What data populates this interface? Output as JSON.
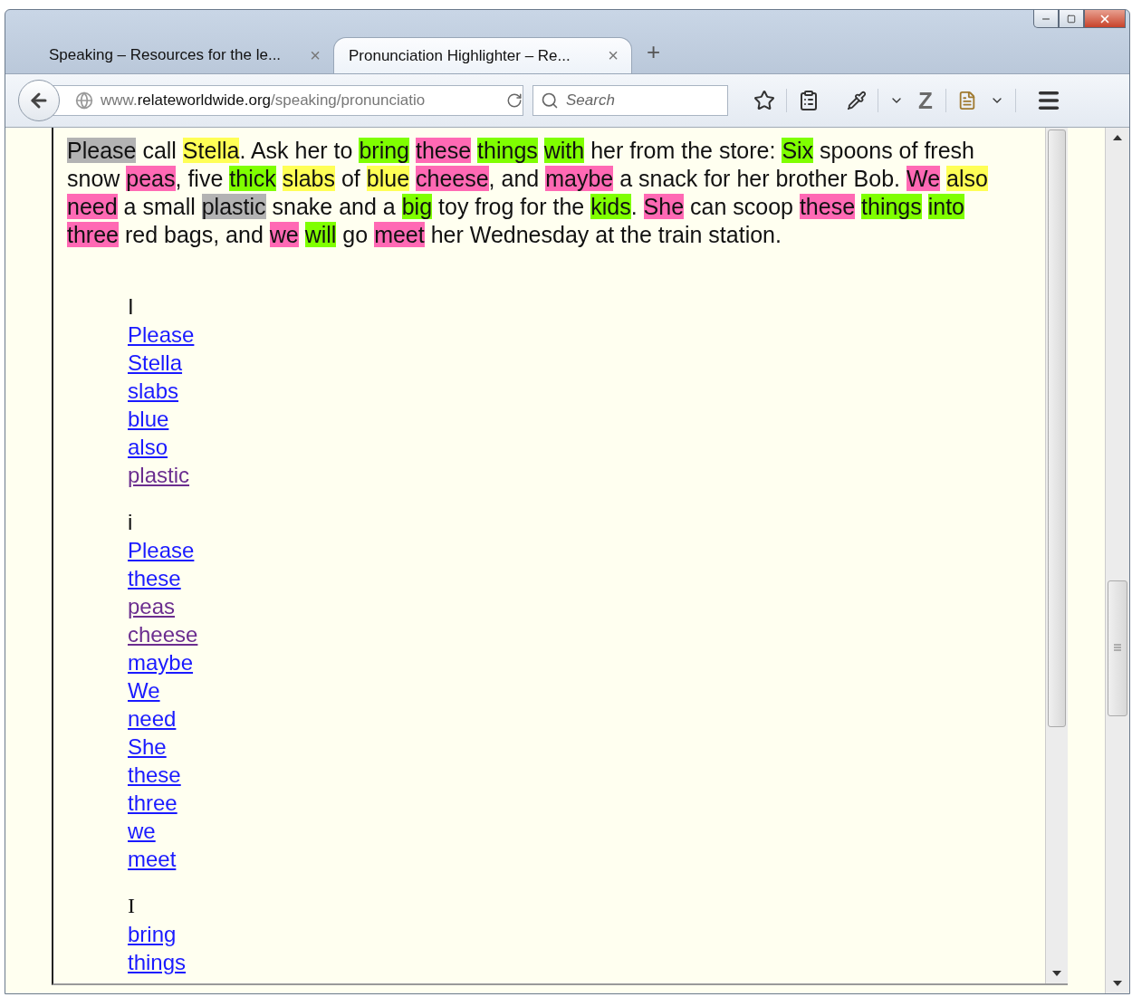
{
  "tabs": [
    {
      "title": "Speaking – Resources for the le...",
      "close": "×",
      "selected": false
    },
    {
      "title": "Pronunciation Highlighter – Re...",
      "close": "×",
      "selected": true
    }
  ],
  "new_tab": "+",
  "address_bar": {
    "url": "www.**relateworldwide.org**/speaking/pronunciatio"
  },
  "search": {
    "placeholder": "Search"
  },
  "toolbar_logo": "Z",
  "paragraph": [
    {
      "text": "Please",
      "color": "#b3b3b3"
    },
    {
      "text": " call "
    },
    {
      "text": "Stella",
      "color": "#ffff55"
    },
    {
      "text": ". Ask her to "
    },
    {
      "text": "bring ",
      "color": "#7fff00"
    },
    {
      "text": "these ",
      "color": "#ff69b4"
    },
    {
      "text": "things ",
      "color": "#7fff00"
    },
    {
      "text": "with",
      "color": "#7fff00"
    },
    {
      "text": " her from the store: "
    },
    {
      "text": "Six",
      "color": "#7fff00"
    },
    {
      "text": " spoons of fresh snow "
    },
    {
      "text": "peas",
      "color": "#ff69b4"
    },
    {
      "text": ", five "
    },
    {
      "text": "thick ",
      "color": "#7fff00"
    },
    {
      "text": "slabs",
      "color": "#ffff55"
    },
    {
      "text": " of "
    },
    {
      "text": "blue ",
      "color": "#ffff55"
    },
    {
      "text": "cheese",
      "color": "#ff69b4"
    },
    {
      "text": ", and "
    },
    {
      "text": "maybe",
      "color": "#ff69b4"
    },
    {
      "text": " a snack for her brother Bob. "
    },
    {
      "text": "We ",
      "color": "#ff69b4"
    },
    {
      "text": "also ",
      "color": "#ffff55"
    },
    {
      "text": "need",
      "color": "#ff69b4"
    },
    {
      "text": " a small "
    },
    {
      "text": "plastic",
      "color": "#b3b3b3"
    },
    {
      "text": " snake and a "
    },
    {
      "text": "big",
      "color": "#7fff00"
    },
    {
      "text": " toy frog for the "
    },
    {
      "text": "kids",
      "color": "#7fff00"
    },
    {
      "text": ". "
    },
    {
      "text": "She",
      "color": "#ff69b4"
    },
    {
      "text": " can scoop "
    },
    {
      "text": "these ",
      "color": "#ff69b4"
    },
    {
      "text": "things ",
      "color": "#7fff00"
    },
    {
      "text": "into ",
      "color": "#7fff00"
    },
    {
      "text": "three",
      "color": "#ff69b4"
    },
    {
      "text": " red bags, and "
    },
    {
      "text": "we ",
      "color": "#ff69b4"
    },
    {
      "text": "will",
      "color": "#7fff00"
    },
    {
      "text": " go "
    },
    {
      "text": "meet",
      "color": "#ff69b4"
    },
    {
      "text": " her Wednesday at the train station."
    }
  ],
  "groups": [
    {
      "heading": "I",
      "kind": "sans",
      "links": [
        {
          "text": "Please",
          "visited": false
        },
        {
          "text": "Stella",
          "visited": false
        },
        {
          "text": "slabs",
          "visited": false
        },
        {
          "text": "blue",
          "visited": false
        },
        {
          "text": "also",
          "visited": false
        },
        {
          "text": "plastic",
          "visited": true
        }
      ]
    },
    {
      "heading": "i",
      "kind": "sans",
      "links": [
        {
          "text": "Please",
          "visited": false
        },
        {
          "text": "these",
          "visited": false
        },
        {
          "text": "peas",
          "visited": true
        },
        {
          "text": "cheese",
          "visited": true
        },
        {
          "text": "maybe",
          "visited": false
        },
        {
          "text": "We",
          "visited": false
        },
        {
          "text": "need",
          "visited": false
        },
        {
          "text": "She",
          "visited": false
        },
        {
          "text": "these",
          "visited": false
        },
        {
          "text": "three",
          "visited": false
        },
        {
          "text": "we",
          "visited": false
        },
        {
          "text": "meet",
          "visited": false
        }
      ]
    },
    {
      "heading": "I",
      "kind": "serif",
      "links": [
        {
          "text": "bring",
          "visited": false
        },
        {
          "text": "things",
          "visited": false
        }
      ]
    }
  ]
}
